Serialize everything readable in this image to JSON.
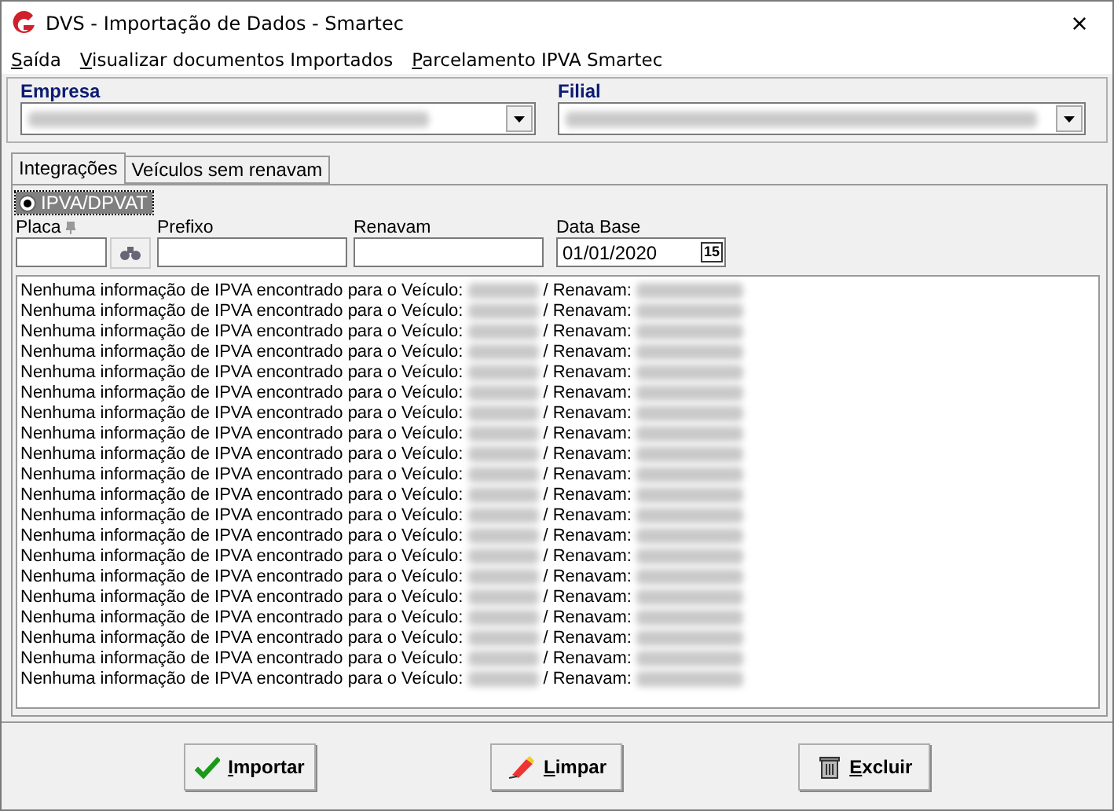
{
  "window": {
    "title": "DVS - Importação de Dados - Smartec",
    "close": "×"
  },
  "menu": [
    {
      "label": "Saída",
      "mnemonic": true
    },
    {
      "label": "Visualizar documentos Importados",
      "mnemonic": true
    },
    {
      "label": "Parcelamento IPVA Smartec",
      "mnemonic": true
    }
  ],
  "empresa": {
    "label": "Empresa"
  },
  "filial": {
    "label": "Filial"
  },
  "tabs": [
    {
      "label": "Integrações",
      "selected": true
    },
    {
      "label": "Veículos sem renavam",
      "selected": false
    }
  ],
  "radio": {
    "label": "IPVA/DPVAT",
    "selected": true
  },
  "fields": [
    {
      "label": "Placa",
      "kind": "search"
    },
    {
      "label": "Prefixo",
      "kind": "text"
    },
    {
      "label": "Renavam",
      "kind": "text"
    },
    {
      "label": "Data Base",
      "kind": "date",
      "value": "01/01/2020",
      "calendar": "15"
    }
  ],
  "log": [
    {
      "text": "Nenhuma informação de IPVA encontrado para o Veículo:",
      "separator": "/ Renavam:"
    },
    {
      "text": "Nenhuma informação de IPVA encontrado para o Veículo:",
      "separator": "/ Renavam:"
    },
    {
      "text": "Nenhuma informação de IPVA encontrado para o Veículo:",
      "separator": "/ Renavam:"
    },
    {
      "text": "Nenhuma informação de IPVA encontrado para o Veículo:",
      "separator": "/ Renavam:"
    },
    {
      "text": "Nenhuma informação de IPVA encontrado para o Veículo:",
      "separator": "/ Renavam:"
    },
    {
      "text": "Nenhuma informação de IPVA encontrado para o Veículo:",
      "separator": "/ Renavam:"
    },
    {
      "text": "Nenhuma informação de IPVA encontrado para o Veículo:",
      "separator": "/ Renavam:"
    },
    {
      "text": "Nenhuma informação de IPVA encontrado para o Veículo:",
      "separator": "/ Renavam:"
    },
    {
      "text": "Nenhuma informação de IPVA encontrado para o Veículo:",
      "separator": "/ Renavam:"
    },
    {
      "text": "Nenhuma informação de IPVA encontrado para o Veículo:",
      "separator": "/ Renavam:"
    },
    {
      "text": "Nenhuma informação de IPVA encontrado para o Veículo:",
      "separator": "/ Renavam:"
    },
    {
      "text": "Nenhuma informação de IPVA encontrado para o Veículo:",
      "separator": "/ Renavam:"
    },
    {
      "text": "Nenhuma informação de IPVA encontrado para o Veículo:",
      "separator": "/ Renavam:"
    },
    {
      "text": "Nenhuma informação de IPVA encontrado para o Veículo:",
      "separator": "/ Renavam:"
    },
    {
      "text": "Nenhuma informação de IPVA encontrado para o Veículo:",
      "separator": "/ Renavam:"
    },
    {
      "text": "Nenhuma informação de IPVA encontrado para o Veículo:",
      "separator": "/ Renavam:"
    },
    {
      "text": "Nenhuma informação de IPVA encontrado para o Veículo:",
      "separator": "/ Renavam:"
    },
    {
      "text": "Nenhuma informação de IPVA encontrado para o Veículo:",
      "separator": "/ Renavam:"
    },
    {
      "text": "Nenhuma informação de IPVA encontrado para o Veículo:",
      "separator": "/ Renavam:"
    },
    {
      "text": "Nenhuma informação de IPVA encontrado para o Veículo:",
      "separator": "/ Renavam:"
    }
  ],
  "buttons": [
    {
      "label": "Importar",
      "kind": "check",
      "mnemonic": true
    },
    {
      "label": "Limpar",
      "kind": "eraser",
      "mnemonic": true
    },
    {
      "label": "Excluir",
      "kind": "trash",
      "mnemonic": true
    }
  ]
}
